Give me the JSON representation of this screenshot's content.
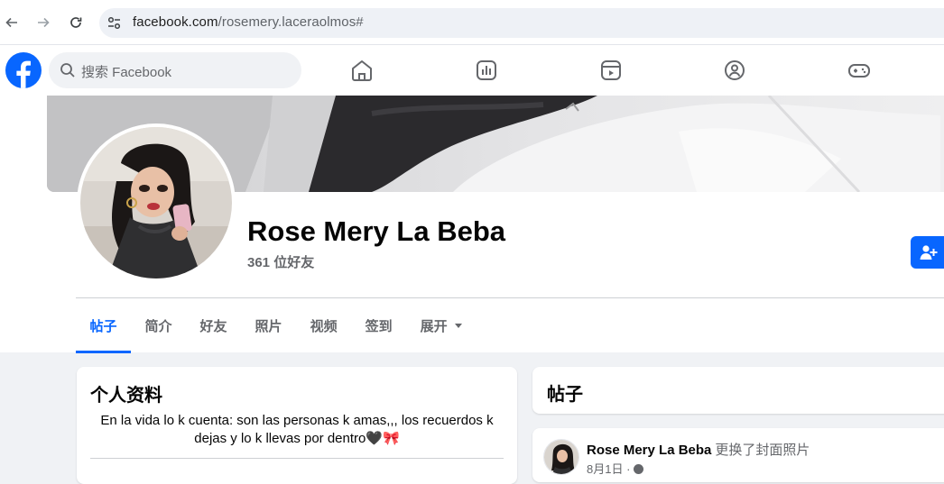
{
  "browser": {
    "url_host": "facebook.com",
    "url_path": "/rosemery.laceraolmos#"
  },
  "header": {
    "search_placeholder": "搜索 Facebook",
    "nav_icons": [
      "home-icon",
      "video-icon",
      "reels-icon",
      "groups-icon",
      "gaming-icon"
    ]
  },
  "profile": {
    "name": "Rose Mery La Beba",
    "friends": "361 位好友"
  },
  "tabs": [
    {
      "label": "帖子",
      "active": true
    },
    {
      "label": "简介",
      "active": false
    },
    {
      "label": "好友",
      "active": false
    },
    {
      "label": "照片",
      "active": false
    },
    {
      "label": "视频",
      "active": false
    },
    {
      "label": "签到",
      "active": false
    },
    {
      "label": "展开",
      "active": false
    }
  ],
  "intro": {
    "title": "个人资料",
    "bio": "En la vida lo k cuenta: son las personas k amas,,, los recuerdos k dejas y lo k llevas por dentro🖤🎀"
  },
  "posts": {
    "title": "帖子",
    "first": {
      "author": "Rose Mery La Beba",
      "action": "更换了封面照片",
      "date": "8月1日 ·"
    }
  },
  "colors": {
    "accent": "#0866ff",
    "secondary_text": "#65676b",
    "page_bg": "#f0f2f5"
  }
}
